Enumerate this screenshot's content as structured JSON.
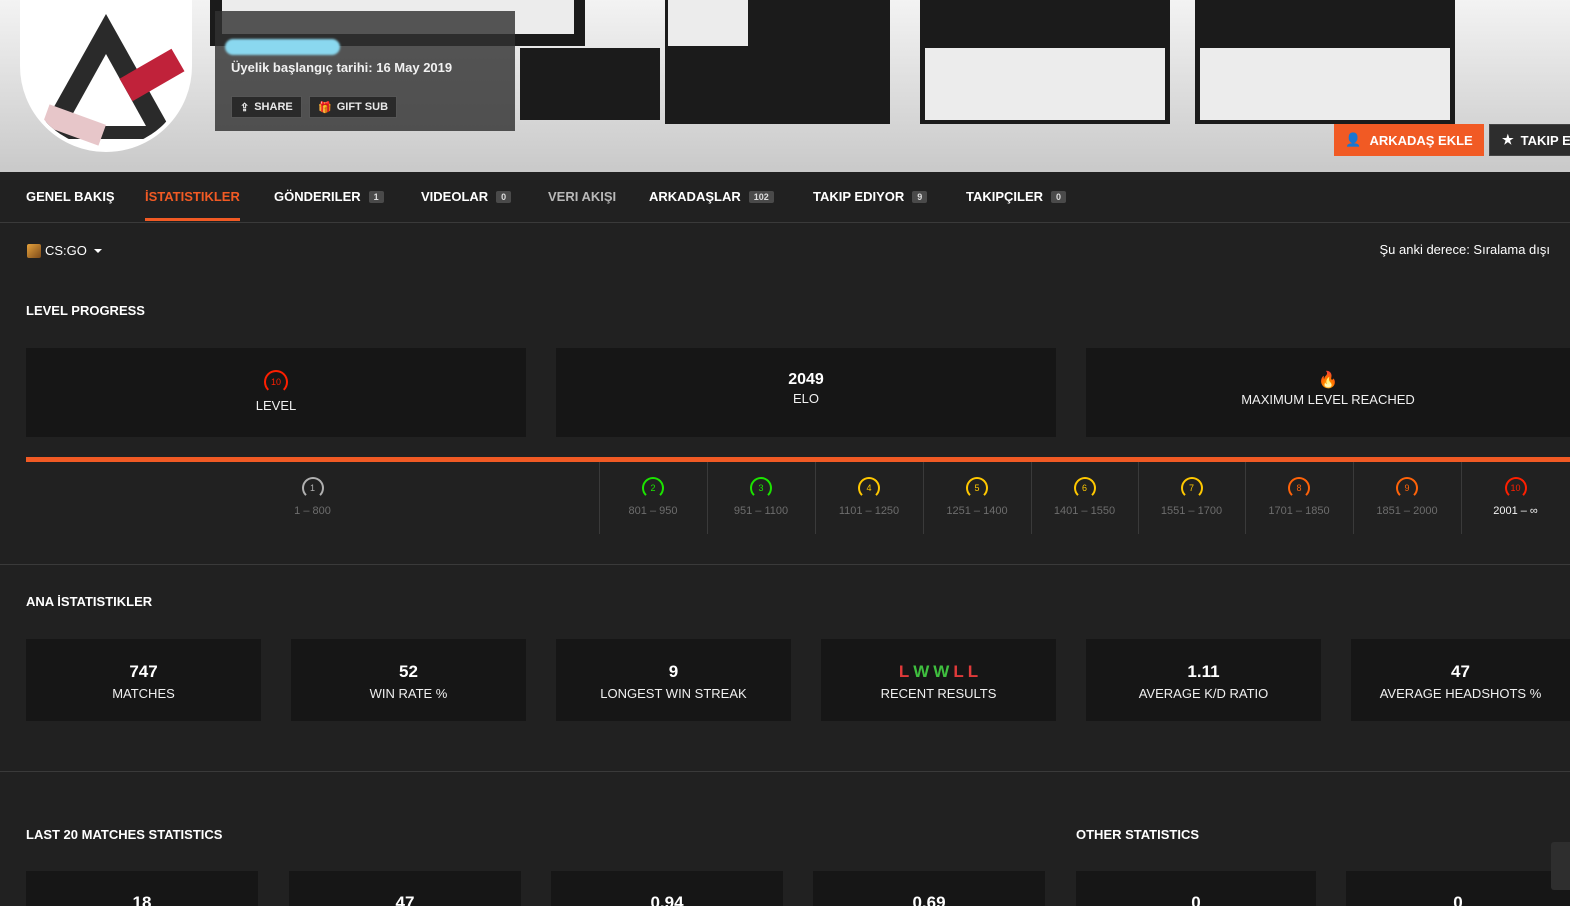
{
  "profile": {
    "member_since": "Üyelik başlangıç tarihi: 16 May 2019",
    "share_label": "SHARE",
    "gift_label": "GIFT SUB",
    "add_friend_label": "ARKADAŞ EKLE",
    "follow_label": "TAKIP ET"
  },
  "tabs": [
    {
      "label": "GENEL BAKIŞ",
      "badge": ""
    },
    {
      "label": "İSTATISTIKLER",
      "badge": ""
    },
    {
      "label": "GÖNDERILER",
      "badge": "1"
    },
    {
      "label": "VIDEOLAR",
      "badge": "0"
    },
    {
      "label": "VERI AKIŞI",
      "badge": ""
    },
    {
      "label": "ARKADAŞLAR",
      "badge": "102"
    },
    {
      "label": "TAKIP EDIYOR",
      "badge": "9"
    },
    {
      "label": "TAKIPÇILER",
      "badge": "0"
    }
  ],
  "game": {
    "name": "CS:GO",
    "rank_text": "Şu anki derece: Sıralama dışı"
  },
  "level_progress": {
    "title": "LEVEL PROGRESS",
    "level": "10",
    "level_label": "LEVEL",
    "elo": "2049",
    "elo_label": "ELO",
    "max_label": "MAXIMUM LEVEL REACHED",
    "ranges": [
      {
        "level": "1",
        "range": "1 – 800",
        "color": "#b0b0b0"
      },
      {
        "level": "2",
        "range": "801 – 950",
        "color": "#1ce400"
      },
      {
        "level": "3",
        "range": "951 – 1100",
        "color": "#1ce400"
      },
      {
        "level": "4",
        "range": "1101 – 1250",
        "color": "#ffc800"
      },
      {
        "level": "5",
        "range": "1251 – 1400",
        "color": "#ffc800"
      },
      {
        "level": "6",
        "range": "1401 – 1550",
        "color": "#ffc800"
      },
      {
        "level": "7",
        "range": "1551 – 1700",
        "color": "#ffc800"
      },
      {
        "level": "8",
        "range": "1701 – 1850",
        "color": "#ff6309"
      },
      {
        "level": "9",
        "range": "1851 – 2000",
        "color": "#ff6309"
      },
      {
        "level": "10",
        "range": "2001 – ∞",
        "color": "#fe1f00"
      }
    ]
  },
  "main_stats": {
    "title": "ANA İSTATISTIKLER",
    "matches": "747",
    "matches_label": "MATCHES",
    "win_rate": "52",
    "win_rate_label": "WIN RATE %",
    "streak": "9",
    "streak_label": "LONGEST WIN STREAK",
    "recent": [
      "L",
      "W",
      "W",
      "L",
      "L"
    ],
    "recent_label": "RECENT RESULTS",
    "kd": "1.11",
    "kd_label": "AVERAGE K/D RATIO",
    "hs": "47",
    "hs_label": "AVERAGE HEADSHOTS %"
  },
  "last20": {
    "title": "LAST 20 MATCHES STATISTICS",
    "values": [
      "18",
      "47",
      "0.94",
      "0.69"
    ]
  },
  "other": {
    "title": "OTHER STATISTICS",
    "values": [
      "0",
      "0"
    ]
  }
}
